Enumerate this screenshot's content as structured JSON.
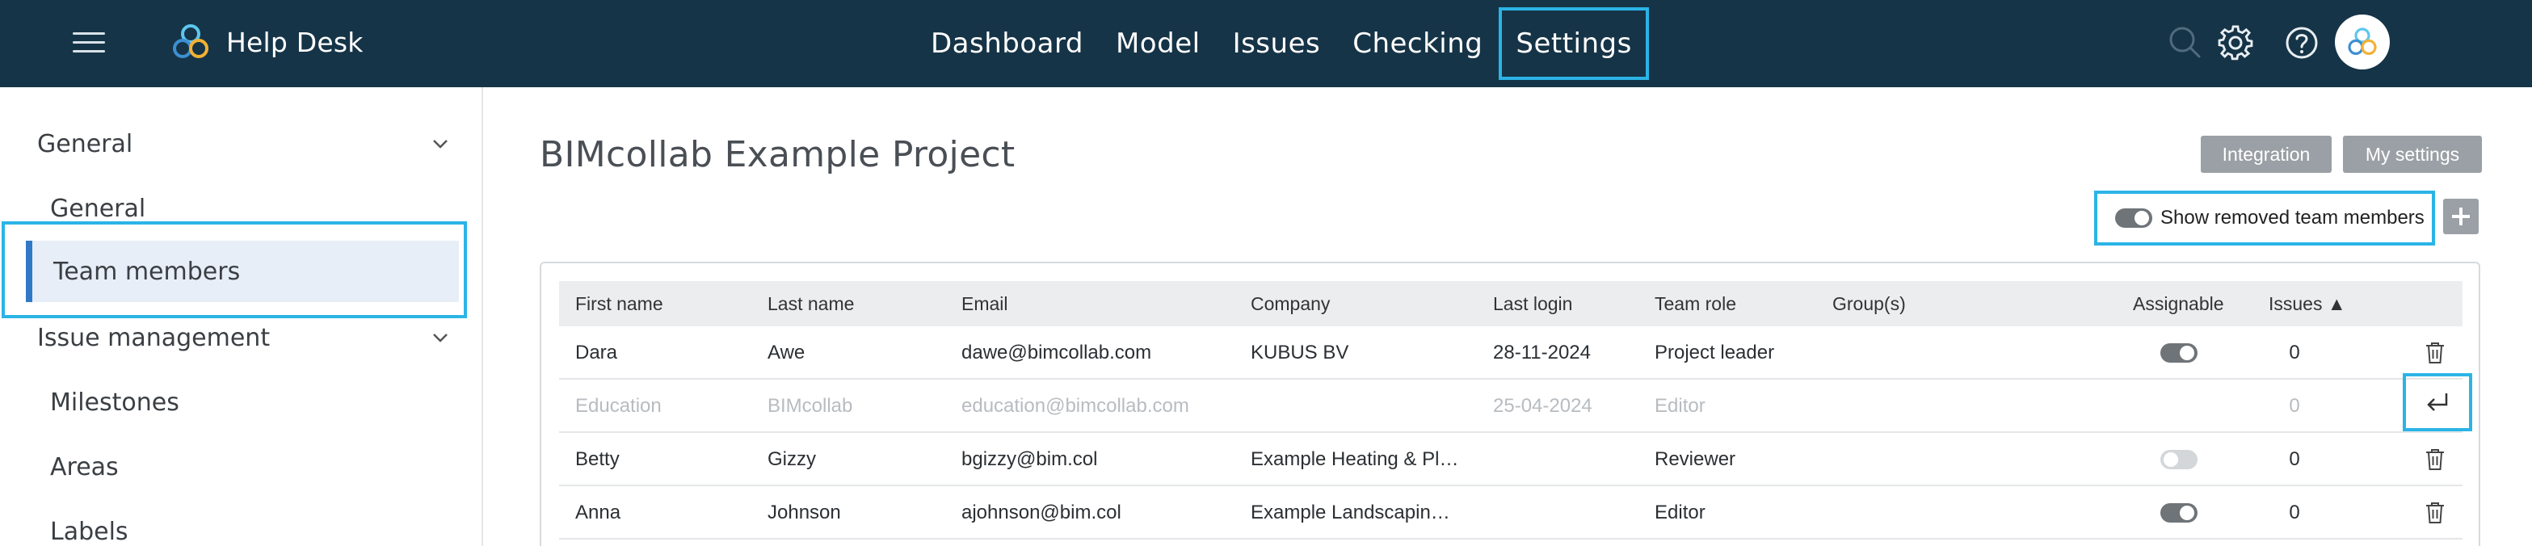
{
  "app": {
    "brand": "Help Desk",
    "nav": [
      "Dashboard",
      "Model",
      "Issues",
      "Checking",
      "Settings"
    ],
    "active_nav": "Settings",
    "icons": [
      "hamburger-icon",
      "search-icon",
      "gear-icon",
      "help-icon",
      "avatar"
    ]
  },
  "sidebar": {
    "sections": [
      {
        "label": "General",
        "items": [
          "General",
          "Team members"
        ]
      },
      {
        "label": "Issue management",
        "items": [
          "Milestones",
          "Areas",
          "Labels"
        ]
      }
    ],
    "active_item": "Team members"
  },
  "main": {
    "title": "BIMcollab Example Project",
    "buttons": {
      "integration": "Integration",
      "my_settings": "My settings"
    },
    "show_removed_label": "Show removed team members",
    "show_removed_on": true
  },
  "table": {
    "columns": {
      "first": "First name",
      "last": "Last name",
      "email": "Email",
      "company": "Company",
      "login": "Last login",
      "role": "Team role",
      "groups": "Group(s)",
      "assignable": "Assignable",
      "issues": "Issues ▲"
    },
    "rows": [
      {
        "first": "Dara",
        "last": "Awe",
        "email": "dawe@bimcollab.com",
        "company": "KUBUS BV",
        "login": "28-11-2024",
        "role": "Project leader",
        "groups": "",
        "assignable": true,
        "issues": "0",
        "removed": false
      },
      {
        "first": "Education",
        "last": "BIMcollab",
        "email": "education@bimcollab.com",
        "company": "",
        "login": "25-04-2024",
        "role": "Editor",
        "groups": "",
        "assignable": null,
        "issues": "0",
        "removed": true
      },
      {
        "first": "Betty",
        "last": "Gizzy",
        "email": "bgizzy@bim.col",
        "company": "Example Heating & Pl…",
        "login": "",
        "role": "Reviewer",
        "groups": "",
        "assignable": false,
        "issues": "0",
        "removed": false
      },
      {
        "first": "Anna",
        "last": "Johnson",
        "email": "ajohnson@bim.col",
        "company": "Example Landscapin…",
        "login": "",
        "role": "Editor",
        "groups": "",
        "assignable": true,
        "issues": "0",
        "removed": false
      }
    ]
  },
  "colors": {
    "topbar": "#163447",
    "highlight": "#2bb4e6",
    "active_bar": "#3178c6",
    "button_grey": "#9aa0a5"
  }
}
